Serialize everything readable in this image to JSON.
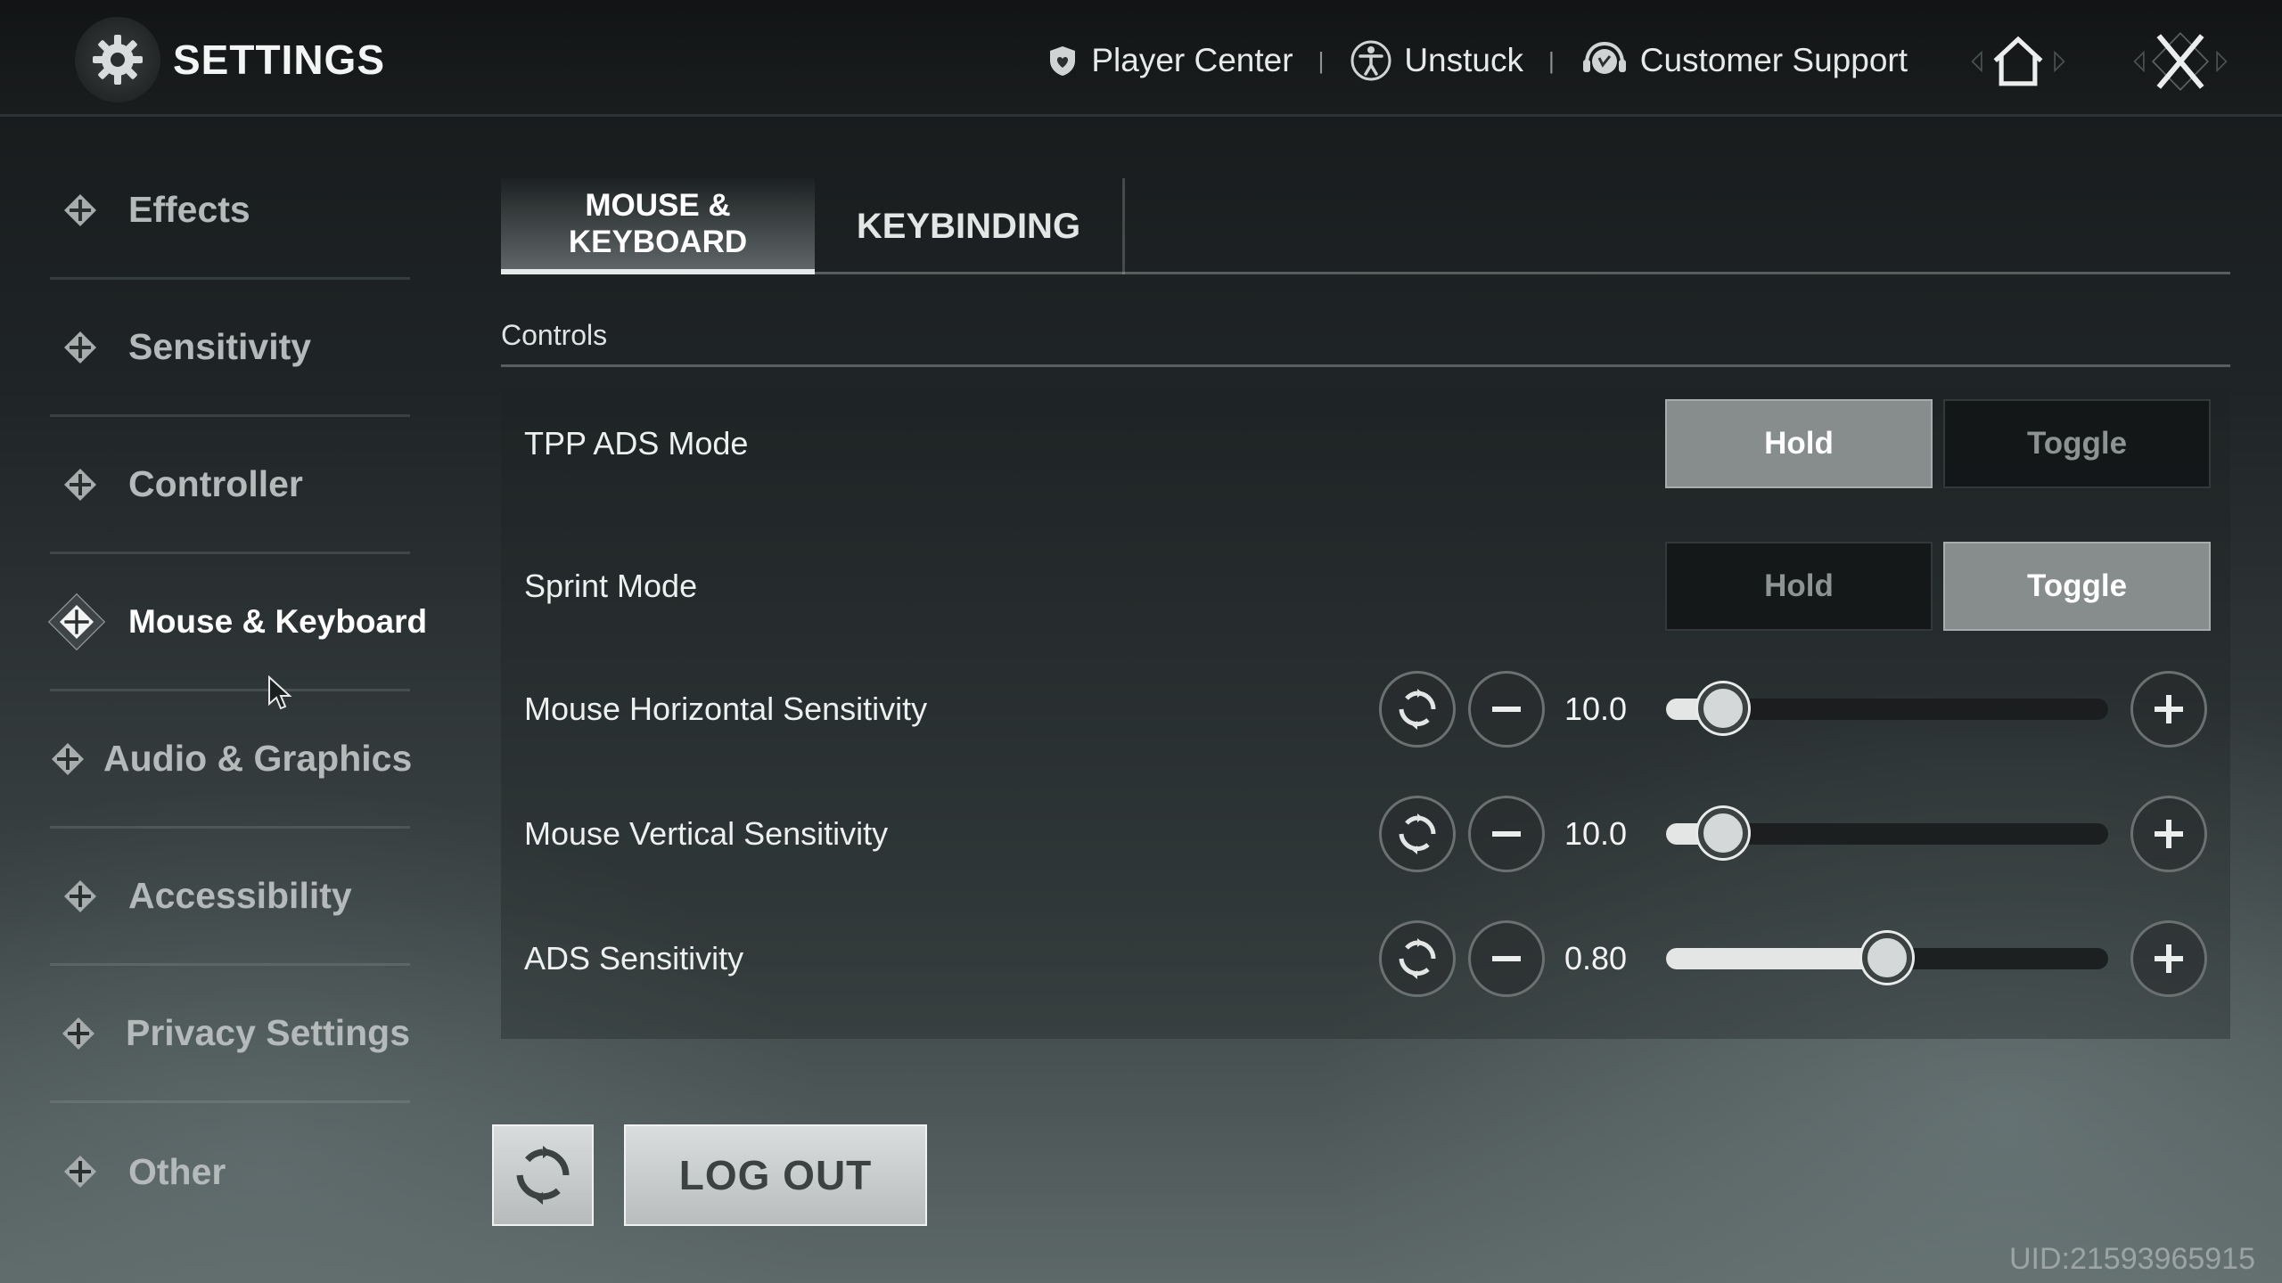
{
  "header": {
    "title": "SETTINGS",
    "links": [
      {
        "label": "Player Center",
        "icon": "shield-heart-icon"
      },
      {
        "label": "Unstuck",
        "icon": "accessibility-person-icon"
      },
      {
        "label": "Customer Support",
        "icon": "headset-icon"
      }
    ]
  },
  "sidebar": {
    "items": [
      {
        "label": "Effects",
        "active": false
      },
      {
        "label": "Sensitivity",
        "active": false
      },
      {
        "label": "Controller",
        "active": false
      },
      {
        "label": "Mouse & Keyboard",
        "active": true
      },
      {
        "label": "Audio & Graphics",
        "active": false
      },
      {
        "label": "Accessibility",
        "active": false
      },
      {
        "label": "Privacy Settings",
        "active": false
      },
      {
        "label": "Other",
        "active": false
      }
    ]
  },
  "tabs": {
    "active_line1": "MOUSE &",
    "active_line2": "KEYBOARD",
    "keybinding": "KEYBINDING"
  },
  "section": {
    "title": "Controls"
  },
  "settings": {
    "tpp_ads": {
      "label": "TPP ADS Mode",
      "opt1": "Hold",
      "opt2": "Toggle",
      "selected": "Hold"
    },
    "sprint": {
      "label": "Sprint Mode",
      "opt1": "Hold",
      "opt2": "Toggle",
      "selected": "Toggle"
    },
    "mouse_h": {
      "label": "Mouse Horizontal Sensitivity",
      "value": "10.0",
      "level": 0.13
    },
    "mouse_v": {
      "label": "Mouse Vertical Sensitivity",
      "value": "10.0",
      "level": 0.13
    },
    "ads": {
      "label": "ADS Sensitivity",
      "value": "0.80",
      "level": 0.5
    }
  },
  "footer": {
    "logout": "LOG OUT",
    "uid": "UID:21593965915"
  },
  "colors": {
    "selected_button": "#878c8c",
    "slider_fill": "#e4e6e6"
  }
}
